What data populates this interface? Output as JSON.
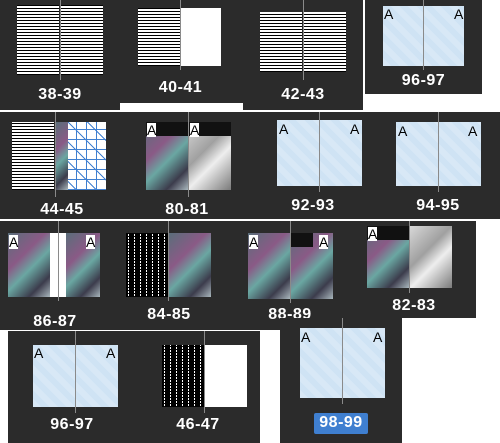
{
  "spreads": [
    {
      "label": "38-39"
    },
    {
      "label": "40-41"
    },
    {
      "label": "42-43"
    },
    {
      "label": "96-97"
    },
    {
      "label": "44-45"
    },
    {
      "label": "80-81"
    },
    {
      "label": "92-93"
    },
    {
      "label": "94-95"
    },
    {
      "label": "86-87"
    },
    {
      "label": "84-85"
    },
    {
      "label": "88-89"
    },
    {
      "label": "82-83"
    },
    {
      "label": "96-97"
    },
    {
      "label": "46-47"
    },
    {
      "label": "98-99",
      "selected": true
    }
  ],
  "master_letter": "A",
  "colors": {
    "tile_bg": "#2b2b2b",
    "selection": "#3f7fd0",
    "master_page": "#cfe3f4"
  }
}
